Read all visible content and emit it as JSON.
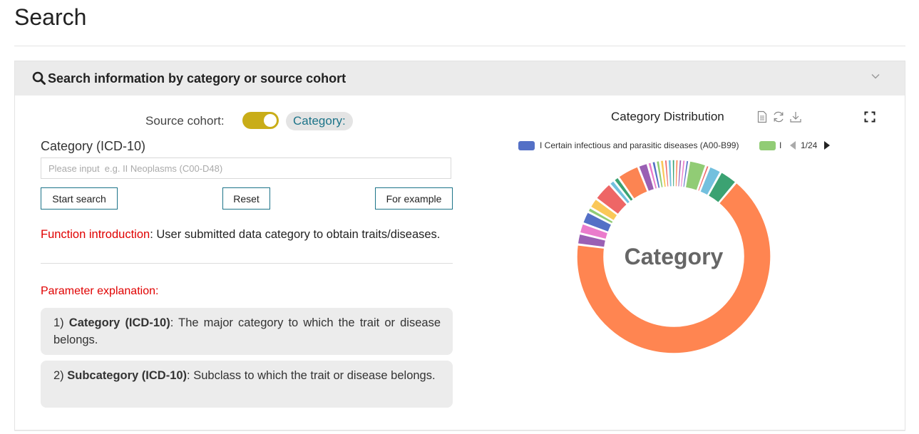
{
  "page": {
    "title": "Search"
  },
  "panel": {
    "title": "Search information by category or source cohort",
    "toggle": {
      "label": "Source cohort:",
      "state": "on",
      "color": "#c9ad18",
      "active_label": "Category:"
    }
  },
  "form": {
    "field_label": "Category (ICD-10)",
    "input_value": "",
    "input_placeholder": "Please input  e.g. II Neoplasms (C00-D48)",
    "buttons": {
      "start": "Start search",
      "reset": "Reset",
      "example": "For example"
    }
  },
  "intro": {
    "label": "Function introduction",
    "text": ": User submitted data category to obtain traits/diseases."
  },
  "params": {
    "heading": "Parameter explanation:",
    "items": [
      {
        "prefix": "1) ",
        "term": "Category (ICD-10)",
        "text": ": The major category to which the trait or disease belongs."
      },
      {
        "prefix": "2) ",
        "term": "Subcategory (ICD-10)",
        "text": ": Subclass to which the trait or disease belongs."
      }
    ]
  },
  "chart": {
    "title": "Category Distribution",
    "toolbox": [
      "data-view-icon",
      "restore-icon",
      "save-image-icon"
    ],
    "legend": [
      {
        "label": "I Certain infectious and parasitic diseases (A00-B99)",
        "color": "#5470c6"
      },
      {
        "label": "I",
        "color": "#91cc75"
      }
    ],
    "legend_page": "1/24",
    "center_label": "Category"
  },
  "chart_data": {
    "type": "pie",
    "title": "Category Distribution",
    "center_label": "Category",
    "note": "Donut chart with rounded segments; values estimated from arc angles.",
    "colors": [
      "#ff8551",
      "#9a60b4",
      "#ea7ccc",
      "#5470c6",
      "#91cc75",
      "#fac858",
      "#ee6666",
      "#73c0de",
      "#3ba272",
      "#fc8452",
      "#9a60b4",
      "#ea7ccc",
      "#5470c6",
      "#91cc75",
      "#fac858",
      "#ee6666",
      "#73c0de",
      "#3ba272",
      "#fc8452",
      "#9a60b4",
      "#ea7ccc",
      "#5470c6",
      "#91cc75",
      "#ee6666",
      "#73c0de",
      "#3ba272"
    ],
    "values": [
      57,
      1.6,
      1.5,
      1.8,
      0.7,
      1.5,
      2.8,
      0.8,
      0.8,
      3.2,
      1.4,
      0.6,
      0.6,
      0.6,
      0.6,
      0.5,
      0.6,
      0.5,
      0.5,
      0.5,
      0.5,
      0.5,
      2.5,
      0.5,
      1.8,
      2.6
    ]
  }
}
